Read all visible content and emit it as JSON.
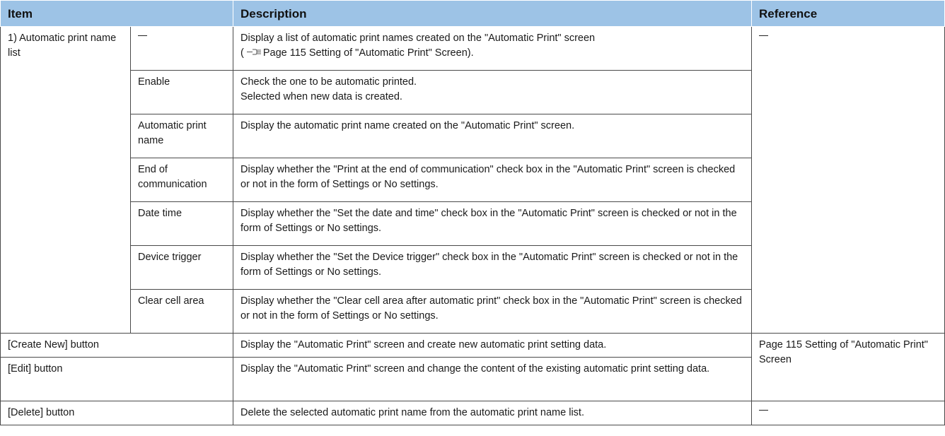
{
  "table": {
    "headers": {
      "item": "Item",
      "description": "Description",
      "reference": "Reference"
    },
    "group1": {
      "label": "1) Automatic print name list",
      "rows": [
        {
          "sub": "—",
          "desc_line1": "Display a list of automatic print names created on the \"Automatic Print\" screen",
          "desc_open": "(",
          "desc_link": "Page 115 Setting of \"Automatic Print\" Screen",
          "desc_close": ").",
          "icon": "page-reference-icon"
        },
        {
          "sub": "Enable",
          "desc": "Check the one to be automatic printed.",
          "desc2": "Selected when new data is created."
        },
        {
          "sub": "Automatic print name",
          "desc": "Display the automatic print name created on the \"Automatic Print\" screen."
        },
        {
          "sub": "End of communication",
          "desc": "Display whether the \"Print at the end of communication\" check box in the \"Automatic Print\" screen is checked or not in the form of Settings or No settings."
        },
        {
          "sub": "Date time",
          "desc": "Display whether the \"Set the date and time\" check box in the \"Automatic Print\" screen is checked or not in the form of Settings or No settings."
        },
        {
          "sub": "Device trigger",
          "desc": "Display whether the \"Set the Device trigger\" check box in the \"Automatic Print\" screen is checked or not in the form of Settings or No settings."
        },
        {
          "sub": "Clear cell area",
          "desc": "Display whether the \"Clear cell area after automatic print\" check box in the \"Automatic Print\" screen is checked or not in the form of Settings or No settings."
        }
      ],
      "reference": "—"
    },
    "buttons": [
      {
        "item": "[Create New] button",
        "desc": "Display the \"Automatic Print\" screen and create new automatic print setting data."
      },
      {
        "item": "[Edit] button",
        "desc": "Display the \"Automatic Print\" screen and change the content of the existing automatic print setting data."
      },
      {
        "item": "[Delete] button",
        "desc": "Delete the selected automatic print name from the automatic print name list.",
        "reference": "—"
      }
    ],
    "shared_reference": "Page 115 Setting of \"Automatic Print\" Screen"
  }
}
